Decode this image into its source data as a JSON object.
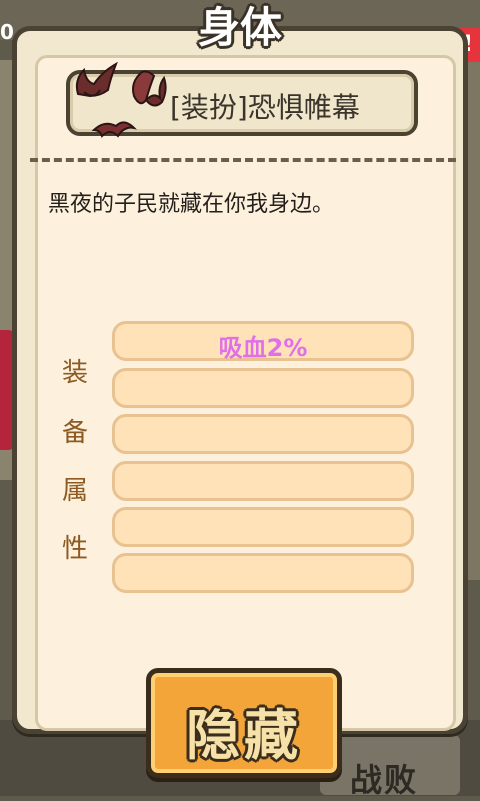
{
  "title": "身体",
  "item": {
    "name": "[装扮]恐惧帷幕",
    "icon": "bat-icon",
    "description": "黑夜的子民就藏在你我身边。"
  },
  "attributes": {
    "label_chars": [
      "装",
      "备",
      "属",
      "性"
    ],
    "slots": [
      "吸血2%",
      "",
      "",
      "",
      "",
      ""
    ]
  },
  "buttons": {
    "hide_label": "隐藏"
  },
  "background": {
    "corner_number": "0",
    "battle_text": "战败"
  },
  "colors": {
    "panel": "#fdf1de",
    "slot": "#ffe2b7",
    "attr_text": "#e070e8",
    "label": "#8c5a22",
    "button": "#f3a53a"
  }
}
